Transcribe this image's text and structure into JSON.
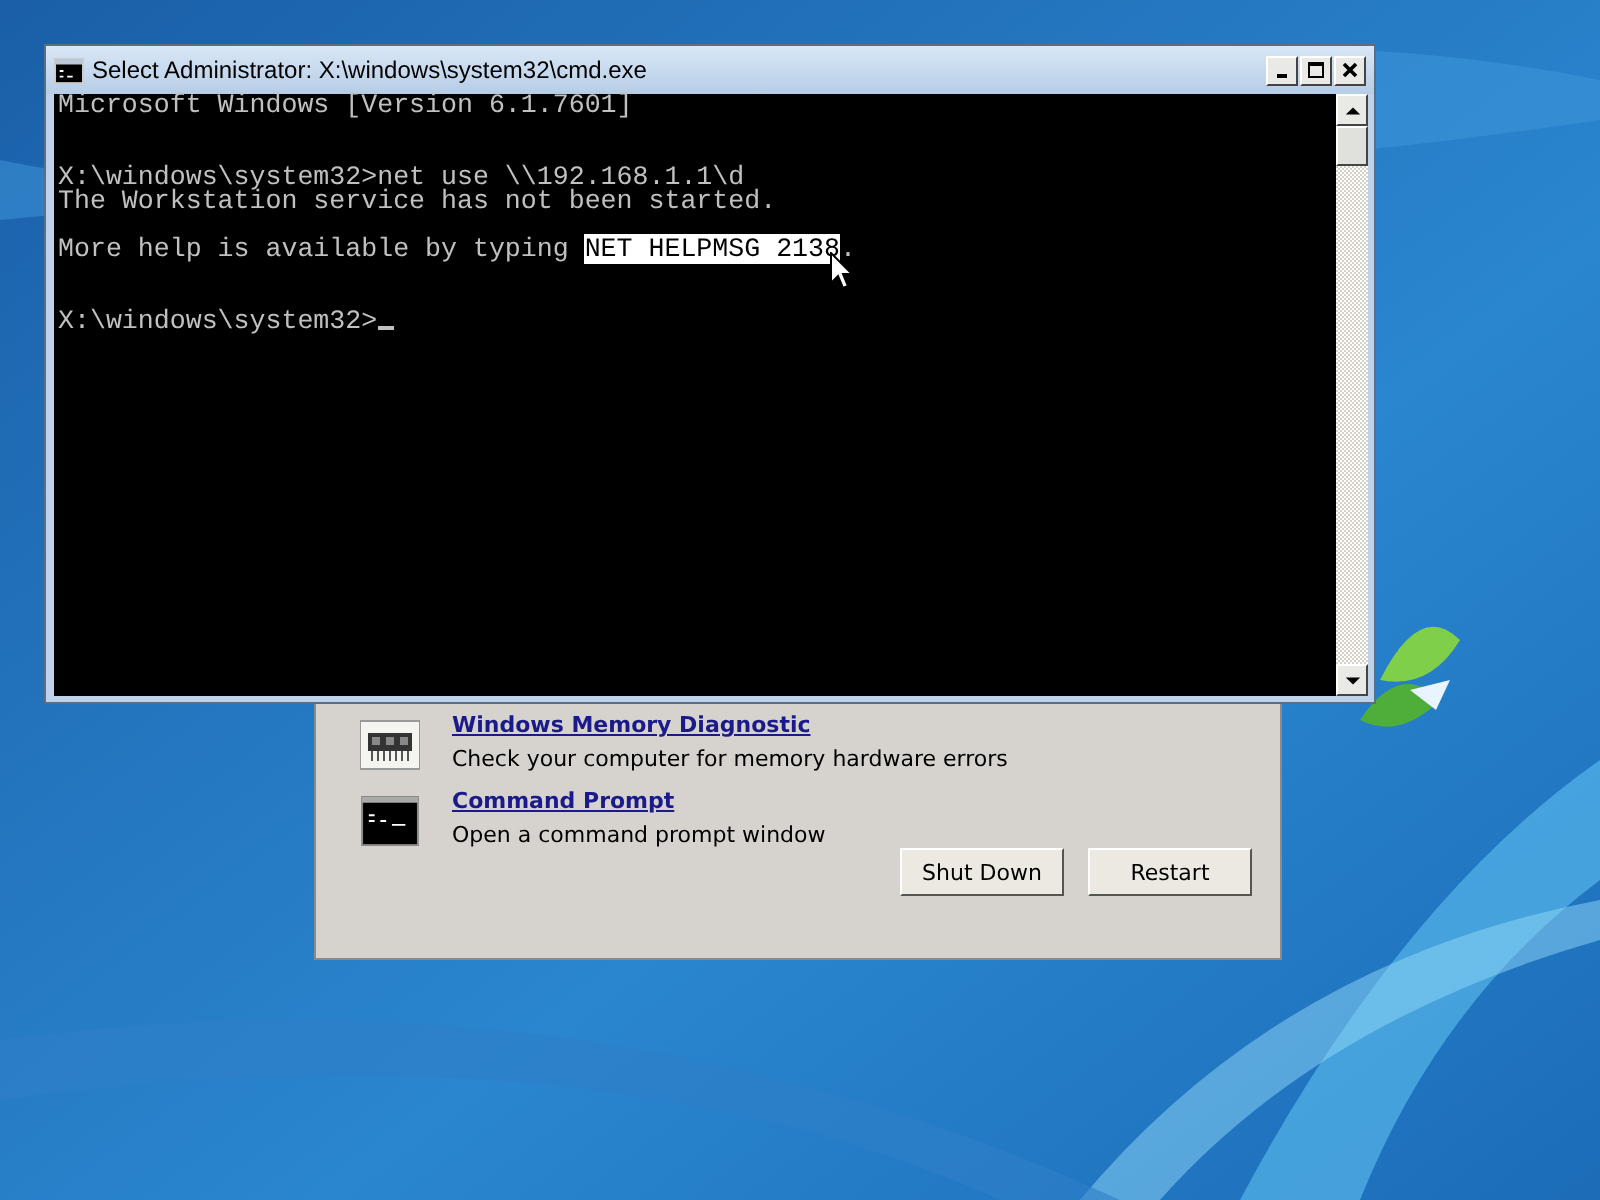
{
  "dialog": {
    "tools": [
      {
        "kind": "memory",
        "title": "Windows Memory Diagnostic",
        "description": "Check your computer for memory hardware errors"
      },
      {
        "kind": "prompt",
        "title": "Command Prompt",
        "description": "Open a command prompt window"
      }
    ],
    "buttons": [
      "Shut Down",
      "Restart"
    ]
  },
  "console": {
    "title": "Select Administrator: X:\\windows\\system32\\cmd.exe",
    "lines": [
      {
        "kind": "text",
        "segments": [
          {
            "text": "Microsoft Windows [Version 6.1.7601]",
            "selected": false
          }
        ]
      },
      {
        "kind": "blank"
      },
      {
        "kind": "blank"
      },
      {
        "kind": "text",
        "segments": [
          {
            "text": "X:\\windows\\system32>net use \\\\192.168.1.1\\d",
            "selected": false
          }
        ]
      },
      {
        "kind": "text",
        "segments": [
          {
            "text": "The Workstation service has not been started.",
            "selected": false
          }
        ]
      },
      {
        "kind": "blank"
      },
      {
        "kind": "text",
        "segments": [
          {
            "text": "More help is available by typing ",
            "selected": false
          },
          {
            "text": "NET HELPMSG 2138",
            "selected": true
          },
          {
            "text": ".",
            "selected": false
          }
        ]
      },
      {
        "kind": "blank"
      },
      {
        "kind": "blank"
      },
      {
        "kind": "text",
        "cursor": true,
        "segments": [
          {
            "text": "X:\\windows\\system32>",
            "selected": false
          }
        ]
      }
    ]
  }
}
